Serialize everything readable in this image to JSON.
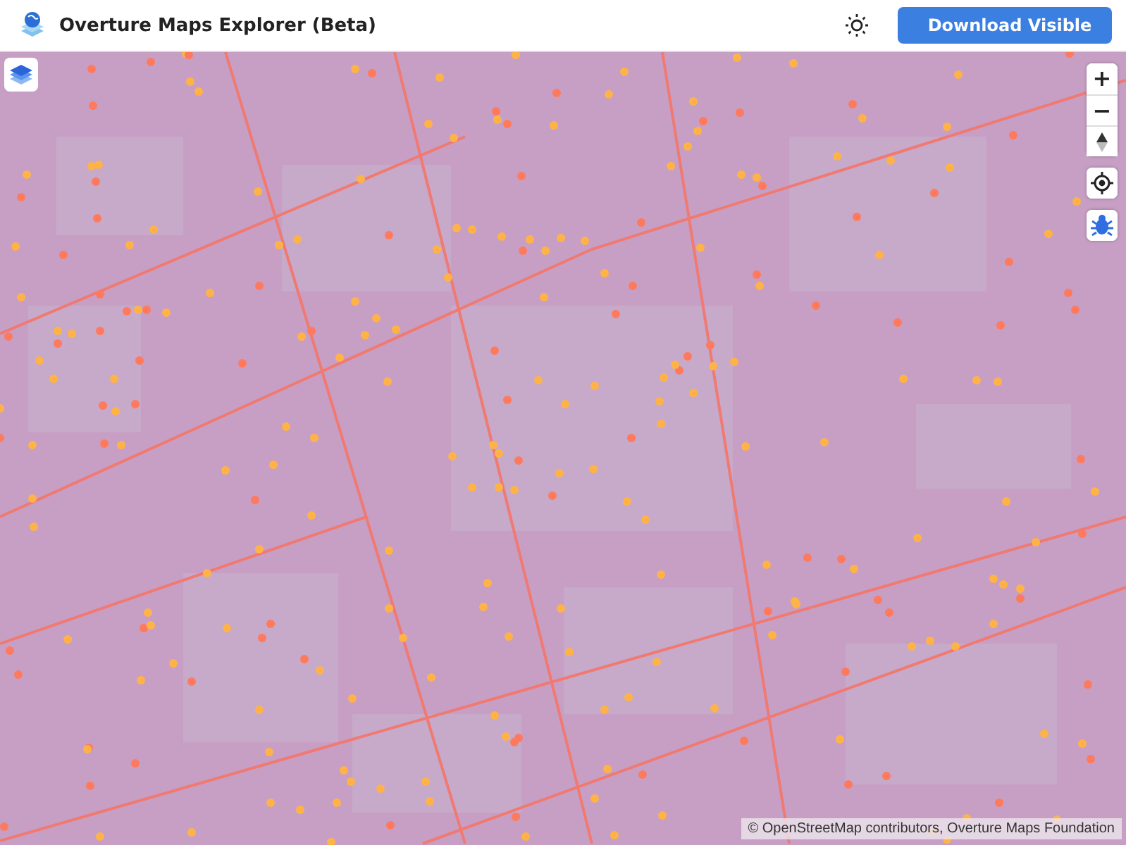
{
  "header": {
    "title": "Overture Maps Explorer (Beta)",
    "download_button": "Download Visible"
  },
  "map": {
    "controls": [
      {
        "kind": "zoom_in",
        "label": "+"
      },
      {
        "kind": "zoom_out",
        "label": "−"
      },
      {
        "kind": "compass"
      },
      {
        "kind": "locate"
      },
      {
        "kind": "inspect"
      }
    ],
    "attribution": "© OpenStreetMap contributors, Overture Maps Foundation"
  }
}
